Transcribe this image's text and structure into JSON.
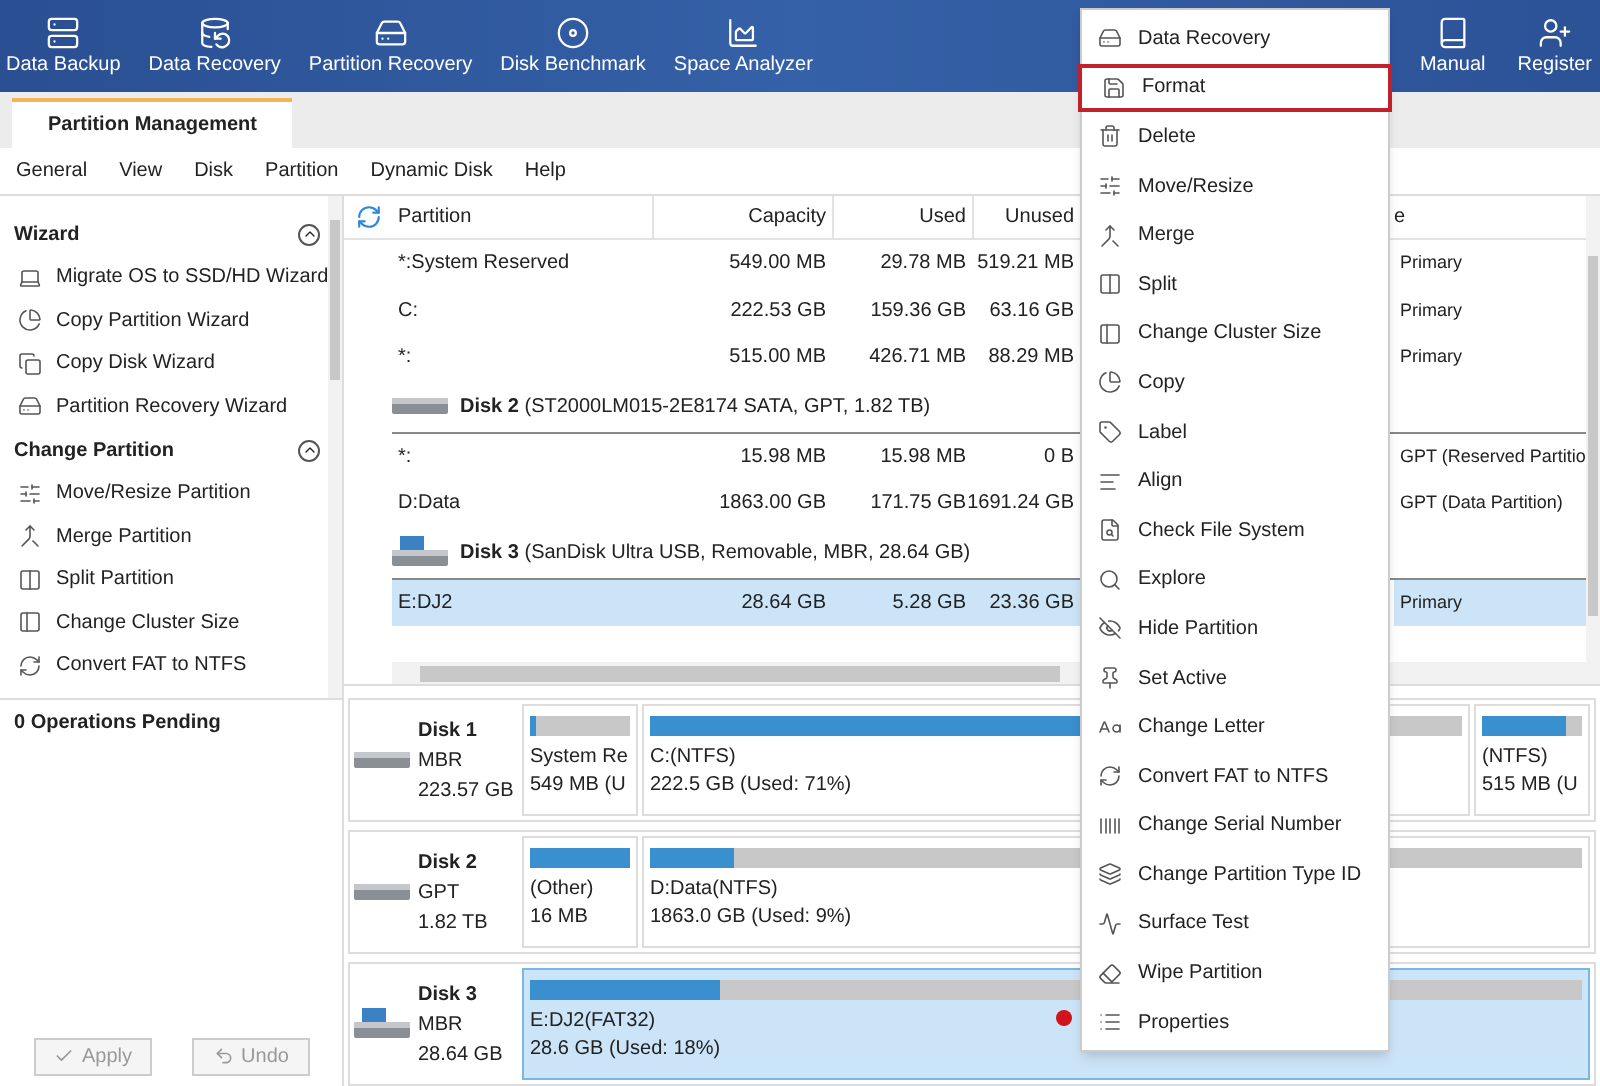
{
  "toolbar": {
    "left": [
      {
        "label": "Data Backup"
      },
      {
        "label": "Data Recovery"
      },
      {
        "label": "Partition Recovery"
      },
      {
        "label": "Disk Benchmark"
      },
      {
        "label": "Space Analyzer"
      }
    ],
    "right": [
      {
        "label": "Manual"
      },
      {
        "label": "Register"
      }
    ]
  },
  "tabs": [
    {
      "label": "Partition Management",
      "selected": true
    }
  ],
  "menu_bar": [
    "General",
    "View",
    "Disk",
    "Partition",
    "Dynamic Disk",
    "Help"
  ],
  "sidebar": {
    "sections": [
      {
        "title": "Wizard",
        "expanded": true,
        "items": [
          "Migrate OS to SSD/HD Wizard",
          "Copy Partition Wizard",
          "Copy Disk Wizard",
          "Partition Recovery Wizard"
        ]
      },
      {
        "title": "Change Partition",
        "expanded": true,
        "items": [
          "Move/Resize Partition",
          "Merge Partition",
          "Split Partition",
          "Change Cluster Size",
          "Convert FAT to NTFS"
        ]
      }
    ],
    "pending": "0 Operations Pending",
    "buttons": [
      {
        "label": "Apply",
        "disabled": true
      },
      {
        "label": "Undo",
        "disabled": true
      }
    ]
  },
  "table": {
    "columns": [
      "Partition",
      "Capacity",
      "Used",
      "Unused",
      "e"
    ],
    "rows": [
      {
        "kind": "partition",
        "selected": false,
        "cells": [
          "*:System Reserved",
          "549.00 MB",
          "29.78 MB",
          "519.21 MB",
          "Primary"
        ]
      },
      {
        "kind": "partition",
        "selected": false,
        "cells": [
          "C:",
          "222.53 GB",
          "159.36 GB",
          "63.16 GB",
          "Primary"
        ]
      },
      {
        "kind": "partition",
        "selected": false,
        "cells": [
          "*:",
          "515.00 MB",
          "426.71 MB",
          "88.29 MB",
          "Primary"
        ]
      },
      {
        "kind": "disk",
        "selected": false,
        "cells": [
          "**Disk 2** (ST2000LM015-2E8174 SATA, GPT, 1.82 TB)"
        ]
      },
      {
        "kind": "partition",
        "selected": false,
        "cells": [
          "*:",
          "15.98 MB",
          "15.98 MB",
          "0 B",
          "GPT (Reserved Partitio"
        ]
      },
      {
        "kind": "partition",
        "selected": false,
        "cells": [
          "D:Data",
          "1863.00 GB",
          "171.75 GB",
          "1691.24 GB",
          "GPT (Data Partition)"
        ]
      },
      {
        "kind": "disk",
        "selected": false,
        "cells": [
          "**Disk 3** (SanDisk Ultra USB, Removable, MBR, 28.64 GB)"
        ]
      },
      {
        "kind": "partition",
        "selected": true,
        "cells": [
          "E:DJ2",
          "28.64 GB",
          "5.28 GB",
          "23.36 GB",
          "Primary"
        ]
      }
    ]
  },
  "disk_map": [
    {
      "name": "Disk 1",
      "style": "MBR",
      "size": "223.57 GB",
      "selected": false,
      "partitions": [
        {
          "label": "System Re",
          "detail": "549 MB (U",
          "level": 0.05
        },
        {
          "label": "C:(NTFS)",
          "detail": "222.5 GB (Used: 71%)",
          "level": 0.71
        },
        {
          "label": "(NTFS)",
          "detail": "515 MB (U",
          "level": 0.83
        }
      ]
    },
    {
      "name": "Disk 2",
      "style": "GPT",
      "size": "1.82 TB",
      "selected": false,
      "partitions": [
        {
          "label": "(Other)",
          "detail": "16 MB",
          "level": 1
        },
        {
          "label": "D:Data(NTFS)",
          "detail": "1863.0 GB (Used: 9%)",
          "level": 0.09
        }
      ]
    },
    {
      "name": "Disk 3",
      "style": "MBR",
      "size": "28.64 GB",
      "selected": true,
      "partitions": [
        {
          "label": "E:DJ2(FAT32)",
          "detail": "28.6 GB (Used: 18%)",
          "level": 0.18
        }
      ]
    }
  ],
  "context_menu": [
    {
      "label": "Data Recovery",
      "selected": false
    },
    {
      "label": "Format",
      "selected": true
    },
    {
      "label": "Delete",
      "selected": false
    },
    {
      "label": "Move/Resize",
      "selected": false
    },
    {
      "label": "Merge",
      "selected": false
    },
    {
      "label": "Split",
      "selected": false
    },
    {
      "label": "Change Cluster Size",
      "selected": false
    },
    {
      "label": "Copy",
      "selected": false
    },
    {
      "label": "Label",
      "selected": false
    },
    {
      "label": "Align",
      "selected": false
    },
    {
      "label": "Check File System",
      "selected": false
    },
    {
      "label": "Explore",
      "selected": false
    },
    {
      "label": "Hide Partition",
      "selected": false
    },
    {
      "label": "Set Active",
      "selected": false
    },
    {
      "label": "Change Letter",
      "selected": false
    },
    {
      "label": "Convert FAT to NTFS",
      "selected": false
    },
    {
      "label": "Change Serial Number",
      "selected": false
    },
    {
      "label": "Change Partition Type ID",
      "selected": false
    },
    {
      "label": "Surface Test",
      "selected": false
    },
    {
      "label": "Wipe Partition",
      "selected": false
    },
    {
      "label": "Properties",
      "selected": false
    }
  ]
}
